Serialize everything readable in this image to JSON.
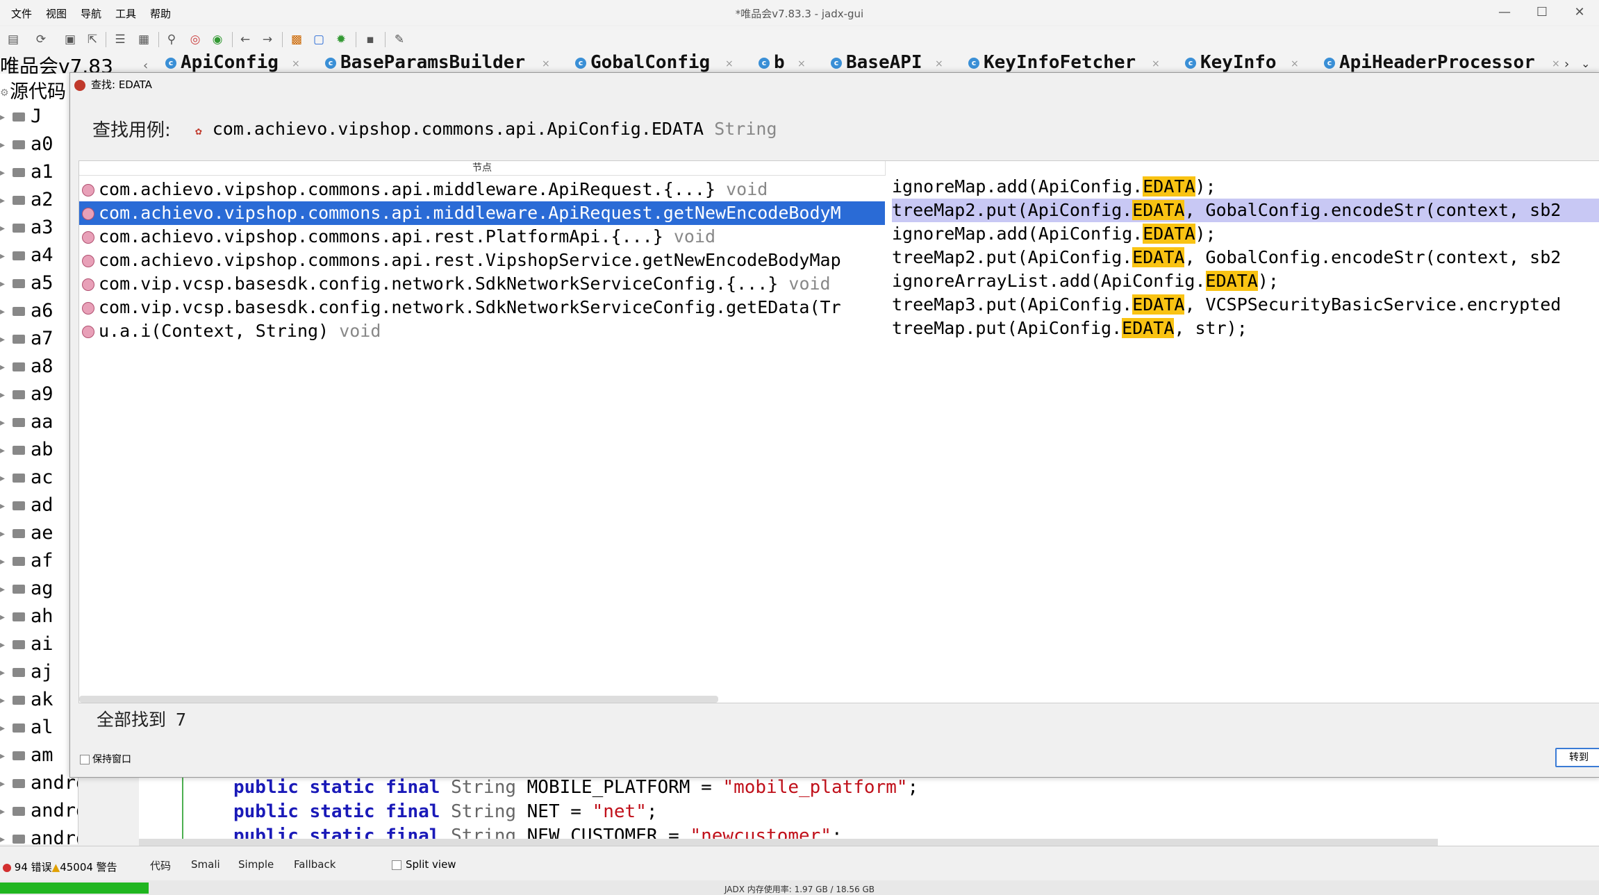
{
  "window": {
    "title": "*唯品会v7.83.3 - jadx-gui",
    "menu": [
      "文件",
      "视图",
      "导航",
      "工具",
      "帮助"
    ],
    "controls": [
      "—",
      "☐",
      "✕"
    ]
  },
  "toolbar": {
    "icons": [
      "open-file-icon",
      "sync-icon",
      "save-icon",
      "export-icon",
      "sync-tree-icon",
      "flatten-icon",
      "search-icon",
      "search-class-icon",
      "search-usage-icon",
      "back-icon",
      "forward-icon",
      "deobfuscate-icon",
      "quark-icon",
      "debug-icon",
      "log-icon",
      "settings-icon"
    ]
  },
  "tabs": {
    "project": "唯品会v7.83",
    "items": [
      "ApiConfig",
      "BaseParamsBuilder",
      "GobalConfig",
      "b",
      "BaseAPI",
      "KeyInfoFetcher",
      "KeyInfo",
      "ApiHeaderProcessor"
    ]
  },
  "tree": {
    "root": "源代码",
    "items": [
      "J",
      "a0",
      "a1",
      "a2",
      "a3",
      "a4",
      "a5",
      "a6",
      "a7",
      "a8",
      "a9",
      "aa",
      "ab",
      "ac",
      "ad",
      "ae",
      "af",
      "ag",
      "ah",
      "ai",
      "aj",
      "ak",
      "al",
      "am",
      "android",
      "androidt",
      "androidx"
    ]
  },
  "dialog": {
    "title": "查找: EDATA",
    "search_label": "查找用例:",
    "target": "com.achievo.vipshop.commons.api.ApiConfig.EDATA",
    "target_type": "String",
    "column_header": "节点",
    "results": [
      {
        "node": "com.achievo.vipshop.commons.api.middleware.ApiRequest.{...}",
        "type": "void",
        "code_pre": "ignoreMap.add(ApiConfig.",
        "code_hl": "EDATA",
        "code_post": ");",
        "selected": false
      },
      {
        "node": "com.achievo.vipshop.commons.api.middleware.ApiRequest.getNewEncodeBodyM",
        "type": "",
        "code_pre": "treeMap2.put(ApiConfig.",
        "code_hl": "EDATA",
        "code_post": ", GobalConfig.encodeStr(context, sb2",
        "selected": true
      },
      {
        "node": "com.achievo.vipshop.commons.api.rest.PlatformApi.{...}",
        "type": "void",
        "code_pre": "ignoreMap.add(ApiConfig.",
        "code_hl": "EDATA",
        "code_post": ");",
        "selected": false
      },
      {
        "node": "com.achievo.vipshop.commons.api.rest.VipshopService.getNewEncodeBodyMap",
        "type": "",
        "code_pre": "treeMap2.put(ApiConfig.",
        "code_hl": "EDATA",
        "code_post": ", GobalConfig.encodeStr(context, sb2",
        "selected": false
      },
      {
        "node": "com.vip.vcsp.basesdk.config.network.SdkNetworkServiceConfig.{...}",
        "type": "void",
        "code_pre": "ignoreArrayList.add(ApiConfig.",
        "code_hl": "EDATA",
        "code_post": ");",
        "selected": false
      },
      {
        "node": "com.vip.vcsp.basesdk.config.network.SdkNetworkServiceConfig.getEData(Tr",
        "type": "",
        "code_pre": "treeMap3.put(ApiConfig.",
        "code_hl": "EDATA",
        "code_post": ", VCSPSecurityBasicService.encrypted",
        "selected": false
      },
      {
        "node": "u.a.i(Context, String)",
        "type": "void",
        "code_pre": "treeMap.put(ApiConfig.",
        "code_hl": "EDATA",
        "code_post": ", str);",
        "selected": false
      }
    ],
    "found_label": "全部找到",
    "found_count": "7",
    "keep_window": "保持窗口",
    "goto_button": "转到"
  },
  "editor": {
    "lines": [
      {
        "kw": "public static final",
        "type": "String",
        "name": "MOBILE_PLATFORM",
        "eq": "=",
        "val": "\"mobile_platform\"",
        "end": ";"
      },
      {
        "kw": "public static final",
        "type": "String",
        "name": "NET",
        "eq": "=",
        "val": "\"net\"",
        "end": ";"
      },
      {
        "kw": "public static final",
        "type": "String",
        "name": "NEW_CUSTOMER",
        "eq": "=",
        "val": "\"newcustomer\"",
        "end": ";"
      }
    ]
  },
  "bottom": {
    "errors": "94 错误",
    "warnings": "45004 警告",
    "tabs": [
      "代码",
      "Smali",
      "Simple",
      "Fallback"
    ],
    "split_view": "Split view",
    "memory": "JADX 内存使用率: 1.97 GB / 18.56 GB"
  }
}
